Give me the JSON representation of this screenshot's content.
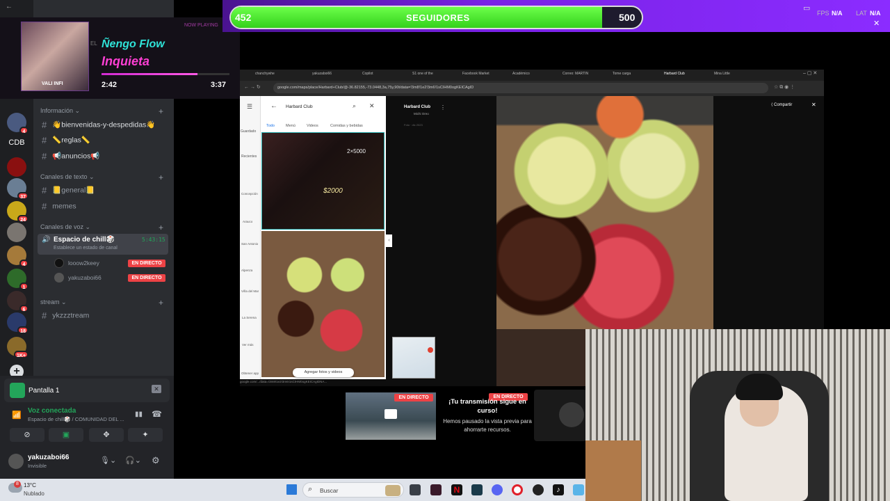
{
  "top_bar": {
    "followers_current": "452",
    "followers_label": "SEGUIDORES",
    "followers_goal": "500",
    "progress_fraction": 0.904,
    "fps_label": "FPS",
    "fps_value": "N/A",
    "lat_label": "LAT",
    "lat_value": "N/A",
    "close": "✕"
  },
  "music": {
    "title": "Ñengo Flow",
    "song": "Inquieta",
    "elapsed": "2:42",
    "total": "3:37",
    "progress_fraction": 0.75,
    "header_fragment": "EL",
    "now_playing_fragment": "NOW PLAYING",
    "cover_text": "VALI INFI"
  },
  "rail": {
    "label_cdb": "CDB",
    "badges": [
      "4",
      "37",
      "24",
      "4",
      "1",
      "6",
      "18",
      "1K+"
    ]
  },
  "channels": {
    "cat_info": "Información",
    "info": [
      "👋bienvenidas-y-despedidas👋",
      "📏reglas📏",
      "📢anuncios📢"
    ],
    "cat_text": "Canales de texto",
    "text": [
      "📒general📒",
      "memes"
    ],
    "cat_voice": "Canales de voz",
    "voice_channel": "Espacio de chill🎲",
    "voice_timer": "5:43:15",
    "voice_status": "Establece un estado de canal",
    "voice_users": [
      "looow2keey",
      "yakuzaboi66"
    ],
    "live_label": "EN DIRECTO",
    "cat_stream": "stream",
    "stream_channel": "ykzzztream"
  },
  "panel": {
    "screen_label": "Pantalla 1",
    "voice_connected": "Voz conectada",
    "voice_sub": "Espacio de chill🎲 / COMUNIDAD DEL ...",
    "username": "yakuzaboi66",
    "status": "Invisible"
  },
  "browser": {
    "tabs": [
      "chanchywhe",
      "yakuzaboi66",
      "Copilot",
      "S1 one of the",
      "Facebook Market",
      "Académico",
      "Correo: MARTIN",
      "Tome carga",
      "Harbard Club",
      "Mina Little"
    ],
    "url": "google.com/maps/place/Harbard+Club/@-36.82155,-73.0448,3a,75y,90t/data=!3m8!1e2!3m6!1sCIHM0ogKEICAgID",
    "search_title": "Harbard Club",
    "maps_tabs": [
      "Todo",
      "Menú",
      "Videos",
      "Comidas y bebidas"
    ],
    "side_labels": [
      "Guardado",
      "Recientes",
      "Concepción",
      "Arauco",
      "San Antonio",
      "Alpenza",
      "Viña del Mar",
      "La Serena",
      "Ver más",
      "Obtener app"
    ],
    "menu_price": "$2000",
    "menu_top": "2×5000",
    "add_photos": "Agregar fotos y videos",
    "photo_place": "Harbard Club",
    "photo_by": "Michi Oreo",
    "photo_date": "Foto · dic 2023",
    "share": "Compartir",
    "status_url": "google.com/.../data=!3m8!1e2!3m6!1sCIHM0ogKEICAgIDNA..."
  },
  "stream_paused": {
    "live": "EN DIRECTO",
    "title": "¡Tu transmisión sigue en curso!",
    "body": "Hemos pausado la vista previa para ahorrarte recursos."
  },
  "taskbar": {
    "weather_temp": "13°C",
    "weather_desc": "Nublado",
    "weather_badge": "8",
    "search": "Buscar"
  },
  "colors": {
    "accent": "#8b2cff",
    "progress": "#3ee11f",
    "live": "#ed4245",
    "discord_bg": "#2b2d31",
    "voice_green": "#23a55a"
  }
}
